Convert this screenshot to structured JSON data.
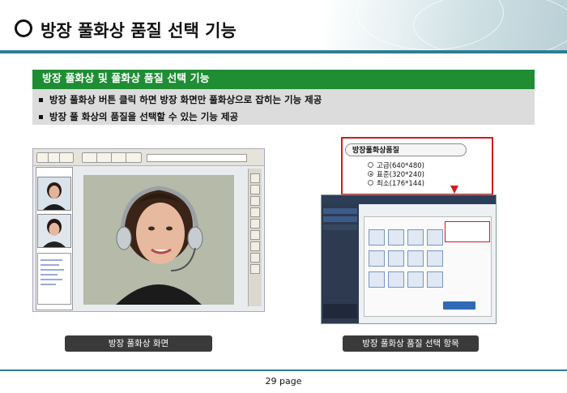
{
  "slide": {
    "title": "방장 풀화상 품질 선택 기능",
    "section_header": "방장 풀화상 및 풀화상 품질 선택 기능",
    "bullets": [
      "방장 풀화상 버튼 클릭 하면 방장 화면만 풀화상으로 잡히는 기능 제공",
      "방장 풀 화상의 품질을 선택할 수 있는 기능 제공"
    ],
    "left_caption": "방장 풀화상 화면",
    "right_caption": "방장 풀화상 품질 선택  항목",
    "page_label": "29 page"
  },
  "quality_popup": {
    "title": "방장풀화상품질",
    "options": [
      {
        "label": "고급(640*480)",
        "selected": false
      },
      {
        "label": "표준(320*240)",
        "selected": true
      },
      {
        "label": "최소(176*144)",
        "selected": false
      }
    ]
  },
  "colors": {
    "accent_line": "#2f7d96",
    "section_green": "#1f8d34",
    "highlight_red": "#d21c1c"
  }
}
